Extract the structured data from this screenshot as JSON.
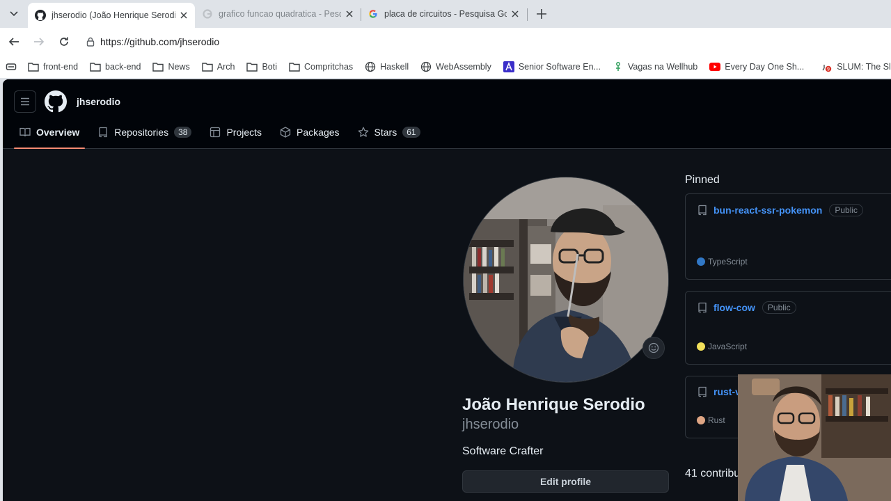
{
  "browser": {
    "tabs": [
      {
        "title": "jhserodio (João Henrique Serodio)",
        "active": true,
        "favicon": "github-icon"
      },
      {
        "title": "grafico funcao quadratica - Pesqui",
        "active": false,
        "favicon": "google-icon"
      },
      {
        "title": "placa de circuitos - Pesquisa Goog",
        "active": false,
        "favicon": "google-icon"
      }
    ],
    "url": "https://github.com/jhserodio",
    "bookmarks": [
      {
        "label": "front-end",
        "icon": "folder-icon"
      },
      {
        "label": "back-end",
        "icon": "folder-icon"
      },
      {
        "label": "News",
        "icon": "folder-icon"
      },
      {
        "label": "Arch",
        "icon": "folder-icon"
      },
      {
        "label": "Boti",
        "icon": "folder-icon"
      },
      {
        "label": "Compritchas",
        "icon": "folder-icon"
      },
      {
        "label": "Haskell",
        "icon": "globe-icon"
      },
      {
        "label": "WebAssembly",
        "icon": "globe-icon"
      },
      {
        "label": "Senior Software En...",
        "icon": "a-logo-icon"
      },
      {
        "label": "Vagas na Wellhub",
        "icon": "wellhub-icon"
      },
      {
        "label": "Every Day One Sh...",
        "icon": "youtube-icon"
      },
      {
        "label": "SLUM: The Sl",
        "icon": "notification-icon"
      }
    ]
  },
  "github": {
    "username": "jhserodio",
    "nav": [
      {
        "label": "Overview",
        "icon": "book-icon",
        "selected": true
      },
      {
        "label": "Repositories",
        "icon": "repo-icon",
        "count": "38"
      },
      {
        "label": "Projects",
        "icon": "table-icon"
      },
      {
        "label": "Packages",
        "icon": "package-icon"
      },
      {
        "label": "Stars",
        "icon": "star-icon",
        "count": "61"
      }
    ],
    "profile": {
      "full_name": "João Henrique Serodio",
      "login": "jhserodio",
      "bio": "Software Crafter",
      "edit_label": "Edit profile"
    },
    "pinned_title": "Pinned",
    "pinned": [
      {
        "name": "bun-react-ssr-pokemon",
        "visibility": "Public",
        "language": "TypeScript",
        "lang_color": "#3178c6"
      },
      {
        "name": "flow-cow",
        "visibility": "Public",
        "language": "JavaScript",
        "lang_color": "#f1e05a"
      },
      {
        "name": "rust-v",
        "visibility": "",
        "language": "Rust",
        "lang_color": "#dea584"
      }
    ],
    "contributions_text": "41 contribu"
  }
}
